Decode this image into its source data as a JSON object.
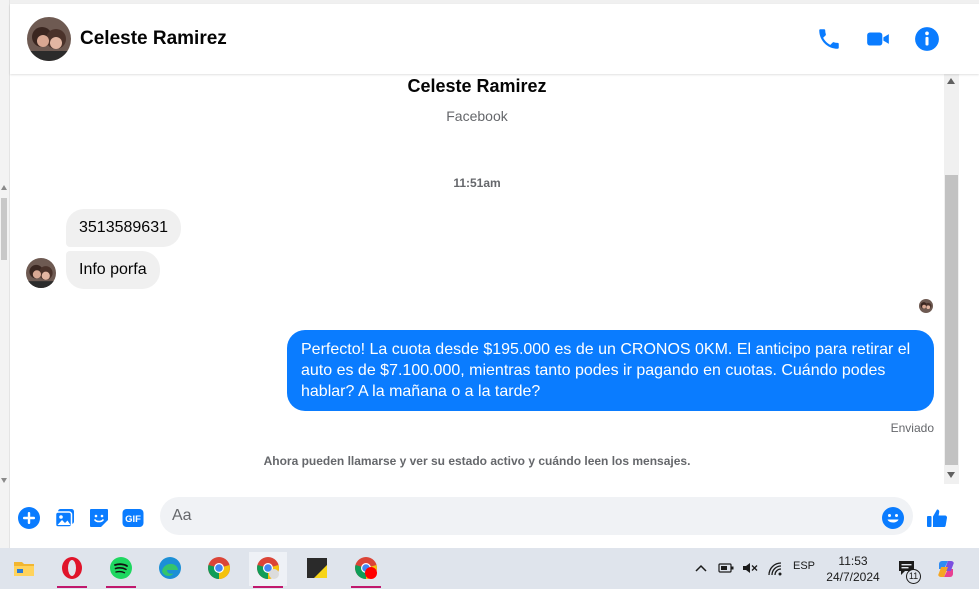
{
  "header": {
    "contact_name": "Celeste Ramirez"
  },
  "conversation": {
    "contact_name": "Celeste Ramirez",
    "contact_source": "Facebook",
    "timestamp": "11:51am",
    "incoming": [
      {
        "text": "3513589631"
      },
      {
        "text": "Info porfa"
      }
    ],
    "outgoing": {
      "text": "Perfecto! La cuota desde $195.000 es de un CRONOS 0KM. El anticipo para retirar el auto es de $7.100.000, mientras tanto podes ir pagando en cuotas. Cuándo podes hablar? A la mañana o a la tarde?",
      "status": "Enviado"
    },
    "system_note": "Ahora pueden llamarse y ver su estado activo y cuándo leen los mensajes."
  },
  "composer": {
    "placeholder": "Aa",
    "gif_label": "GIF"
  },
  "taskbar": {
    "language": "ESP",
    "time": "11:53",
    "date": "24/7/2024",
    "notification_count": "11"
  },
  "colors": {
    "accent": "#0a7cff",
    "incoming_bubble": "#f0f0f0"
  }
}
